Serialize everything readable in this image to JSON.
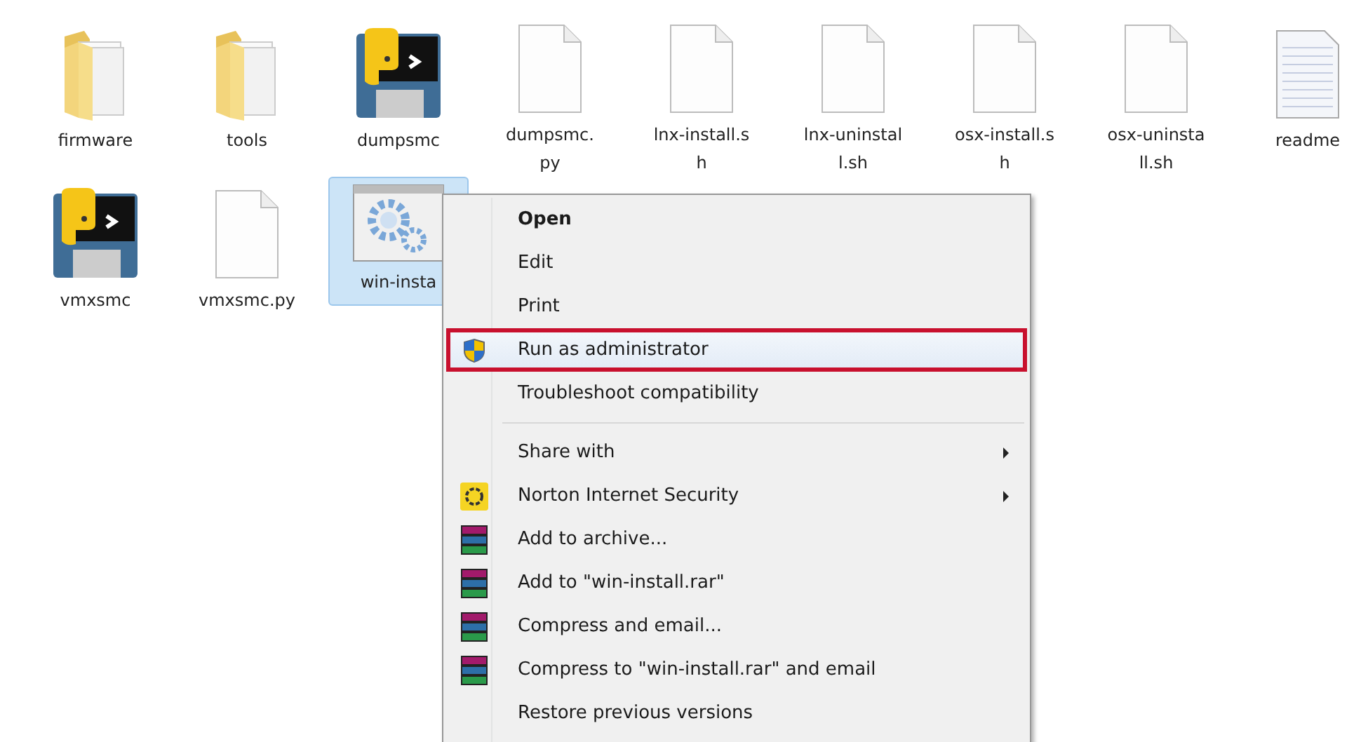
{
  "files": [
    {
      "kind": "folder",
      "label_lines": [
        "firmware"
      ],
      "selected": false
    },
    {
      "kind": "folder",
      "label_lines": [
        "tools"
      ],
      "selected": false
    },
    {
      "kind": "python",
      "label_lines": [
        "dumpsmc"
      ],
      "selected": false
    },
    {
      "kind": "file",
      "label_lines": [
        "dumpsmc.",
        "py"
      ],
      "selected": false
    },
    {
      "kind": "file",
      "label_lines": [
        "lnx-install.s",
        "h"
      ],
      "selected": false
    },
    {
      "kind": "file",
      "label_lines": [
        "lnx-uninstal",
        "l.sh"
      ],
      "selected": false
    },
    {
      "kind": "file",
      "label_lines": [
        "osx-install.s",
        "h"
      ],
      "selected": false
    },
    {
      "kind": "file",
      "label_lines": [
        "osx-uninsta",
        "ll.sh"
      ],
      "selected": false
    },
    {
      "kind": "text",
      "label_lines": [
        "readme"
      ],
      "selected": false
    },
    {
      "kind": "python",
      "label_lines": [
        "vmxsmc"
      ],
      "selected": false
    },
    {
      "kind": "file",
      "label_lines": [
        "vmxsmc.py"
      ],
      "selected": false
    },
    {
      "kind": "exe",
      "label_lines": [
        "win-insta"
      ],
      "selected": true
    }
  ],
  "context_menu": {
    "groups": [
      [
        {
          "label": "Open",
          "kind": "plain",
          "bold": true,
          "submenu": false,
          "selected": false
        },
        {
          "label": "Edit",
          "kind": "plain",
          "bold": false,
          "submenu": false,
          "selected": false
        },
        {
          "label": "Print",
          "kind": "plain",
          "bold": false,
          "submenu": false,
          "selected": false
        },
        {
          "label": "Run as administrator",
          "kind": "shield",
          "bold": false,
          "submenu": false,
          "selected": true
        },
        {
          "label": "Troubleshoot compatibility",
          "kind": "plain",
          "bold": false,
          "submenu": false,
          "selected": false
        }
      ],
      [
        {
          "label": "Share with",
          "kind": "plain",
          "bold": false,
          "submenu": true,
          "selected": false
        },
        {
          "label": "Norton Internet Security",
          "kind": "norton",
          "bold": false,
          "submenu": true,
          "selected": false
        },
        {
          "label": "Add to archive...",
          "kind": "rar",
          "bold": false,
          "submenu": false,
          "selected": false
        },
        {
          "label": "Add to \"win-install.rar\"",
          "kind": "rar",
          "bold": false,
          "submenu": false,
          "selected": false
        },
        {
          "label": "Compress and email...",
          "kind": "rar",
          "bold": false,
          "submenu": false,
          "selected": false
        },
        {
          "label": "Compress to \"win-install.rar\" and email",
          "kind": "rar",
          "bold": false,
          "submenu": false,
          "selected": false
        },
        {
          "label": "Restore previous versions",
          "kind": "plain",
          "bold": false,
          "submenu": false,
          "selected": false
        }
      ]
    ]
  }
}
